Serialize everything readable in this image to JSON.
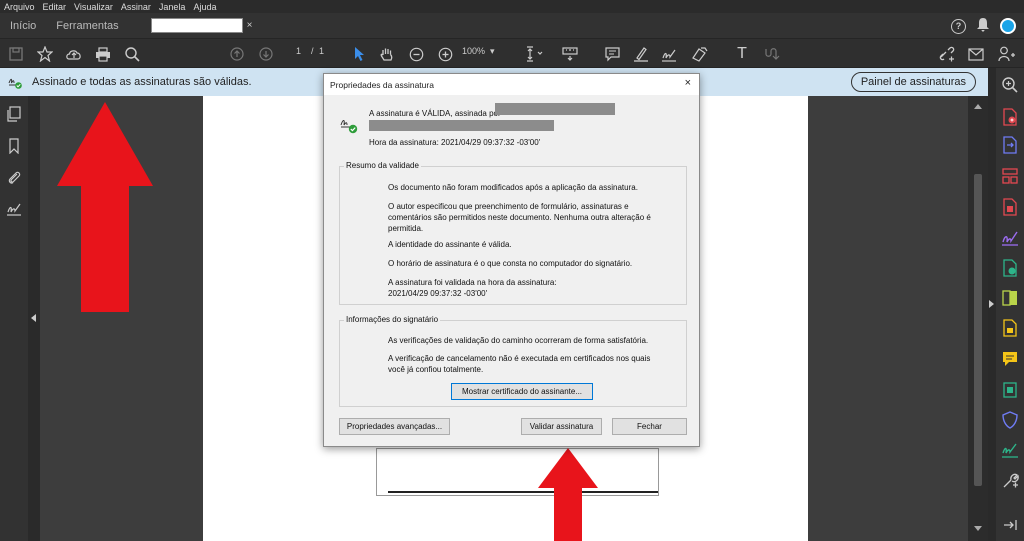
{
  "menu": [
    "Arquivo",
    "Editar",
    "Visualizar",
    "Assinar",
    "Janela",
    "Ajuda"
  ],
  "tabs": {
    "home": "Início",
    "tools": "Ferramentas",
    "doc_close": "×"
  },
  "toolbar": {
    "page_current": "1",
    "page_sep": "/",
    "page_total": "1",
    "zoom": "100%"
  },
  "sigbar": {
    "status": "Assinado e todas as assinaturas são válidas.",
    "panel_button": "Painel de assinaturas"
  },
  "dialog": {
    "title": "Propriedades da assinatura",
    "close": "×",
    "valid_text": "A assinatura é VÁLIDA, assinada por",
    "time_text": "Hora da assinatura:  2021/04/29 09:37:32 -03'00'",
    "validity_group": {
      "label": "Resumo da validade",
      "lines": [
        "Os documento não foram modificados após a aplicação da assinatura.",
        "O autor especificou que preenchimento de formulário, assinaturas e comentários são permitidos neste documento. Nenhuma outra alteração é permitida.",
        "A identidade do assinante é válida.",
        "O horário de assinatura é o que consta no computador do signatário.",
        "A assinatura foi validada na hora da assinatura:\n2021/04/29 09:37:32 -03'00'"
      ]
    },
    "signer_group": {
      "label": "Informações do signatário",
      "lines": [
        "As verificações de validação do caminho ocorreram de forma satisfatória.",
        "A verificação de cancelamento não é executada em certificados nos quais você já confiou totalmente."
      ],
      "cert_button": "Mostrar certificado do assinante..."
    },
    "buttons": {
      "advanced": "Propriedades avançadas...",
      "validate": "Validar assinatura",
      "close": "Fechar"
    }
  },
  "colors": {
    "accent_red": "#e8141b",
    "sigbar_bg": "#cfe3f2",
    "avatar": "#1aa4e8"
  }
}
